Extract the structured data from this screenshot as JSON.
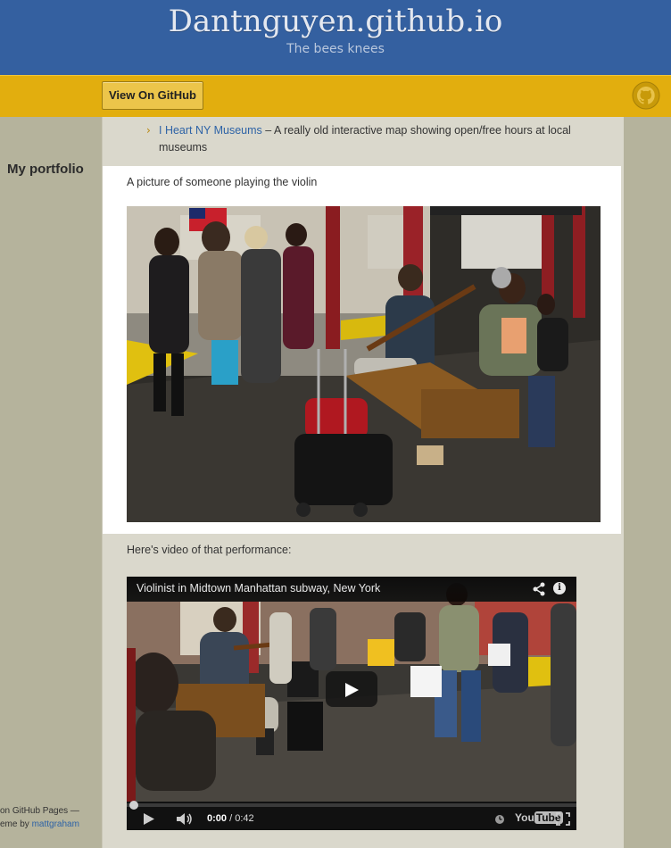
{
  "header": {
    "title": "Dantnguyen.github.io",
    "tagline": "The bees knees"
  },
  "nav": {
    "github_button": "View On GitHub",
    "octocat_icon": "github-octocat-icon"
  },
  "sidebar": {
    "portfolio": "My portfolio",
    "credit_line1": "on GitHub Pages —",
    "credit_line2_prefix": "eme by ",
    "credit_author": "mattgraham"
  },
  "content": {
    "list_item_link": "I Heart NY Museums",
    "list_item_text": " – A really old interactive map showing open/free hours at local museums",
    "photo_caption": "A picture of someone playing the violin",
    "video_caption": "Here's video of that performance:"
  },
  "video": {
    "title": "Violinist in Midtown Manhattan subway, New York",
    "current_time": "0:00",
    "duration": "/ 0:42",
    "brand": "YouTube",
    "progress": 0
  },
  "colors": {
    "header_bg": "#3460a0",
    "nav_bg": "#e2ae0e",
    "page_bg": "#b5b39c",
    "main_bg": "#dad8cc",
    "link": "#2e63a6"
  }
}
